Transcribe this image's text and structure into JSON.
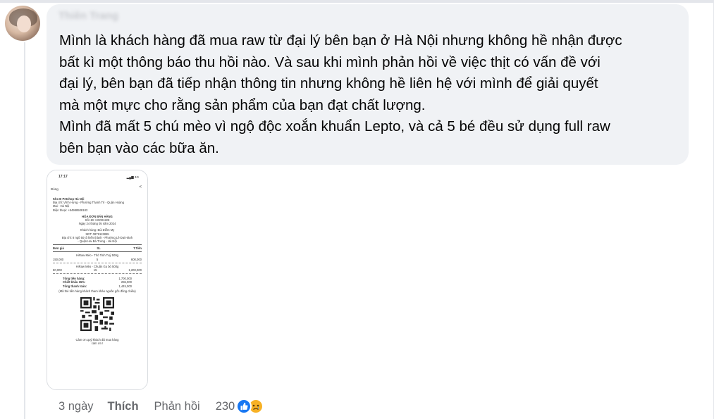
{
  "comment": {
    "author": "Thiên Trang",
    "lines": [
      "Mình là khách hàng đã mua raw từ đại lý bên bạn ở Hà Nội nhưng không hề nhận được",
      "bất kì một thông báo thu hồi nào. Và sau khi mình phản hồi về việc thịt có vấn đề với",
      "đại lý, bên bạn đã tiếp nhận thông tin nhưng không hề liên hệ với mình để giải quyết",
      "mà một mực cho rằng sản phẩm của bạn đạt chất lượng.",
      "Mình đã mất 5 chú mèo vì ngộ độc xoắn khuẩn Lepto, và cả 5 bé đều sử dụng full raw",
      "bên bạn vào các bữa ăn."
    ]
  },
  "receipt": {
    "status_time": "17:17",
    "status_signal": "4G",
    "close_label": "Đóng",
    "shop": "Kho Đ Petshop Hà Nội",
    "address_1": "Địa chỉ: Vĩnh Hưng - Phường Thanh Trì - Quận Hoàng",
    "address_2": "Mai - Hà Nội",
    "phone": "Điện thoại: +84988508183",
    "title": "HÓA ĐƠN BÁN HÀNG",
    "invoice_no": "Số HĐ: HD001228",
    "date": "Ngày 24 tháng 05 năm 2024",
    "customer": "Khách hàng: Bùi Diễm My",
    "customer_phone": "SĐT: 0879113855",
    "customer_address_1": "Địa chỉ: 8 ngõ 50 tô hiến thành - Phường Lê Đại Hành",
    "customer_address_2": "- Quận Hai Bà Trưng - Hà Nội",
    "col_price": "Đơn giá",
    "col_qty": "SL",
    "col_total": "T.Tiền",
    "items": [
      {
        "name": "HiRaw Mèo - Thỏ Tinh Tuý 500g",
        "price": "150,000",
        "qty": "5",
        "total": "600,000"
      },
      {
        "name": "HiRaw Mèo - Chuẩn Gu bò 500g",
        "price": "80,000",
        "qty": "15",
        "total": "1,200,000"
      }
    ],
    "subtotal_label": "Tổng tiền hàng:",
    "subtotal": "1,700,000",
    "discount_label": "Chiết khấu 15%:",
    "discount": "255,000",
    "grand_label": "Tổng thanh toán:",
    "grand": "1,445,000",
    "qr_note": "(Mã thẻ tiền hàng khách tham khảo nguồn gốc đồng chiều)",
    "footer_1": "Cảm ơn quý khách đã mua hàng",
    "footer_2": "cảm ơn !"
  },
  "actions": {
    "time": "3 ngày",
    "like": "Thích",
    "reply": "Phản hồi",
    "reaction_count": "230"
  },
  "colors": {
    "like_blue": "#1877f2",
    "sad_yellow": "#f7b125",
    "bubble_bg": "#f0f2f5",
    "meta_gray": "#65676b"
  },
  "icons": [
    "like-reaction-icon",
    "sad-reaction-icon",
    "share-icon",
    "signal-icon"
  ]
}
